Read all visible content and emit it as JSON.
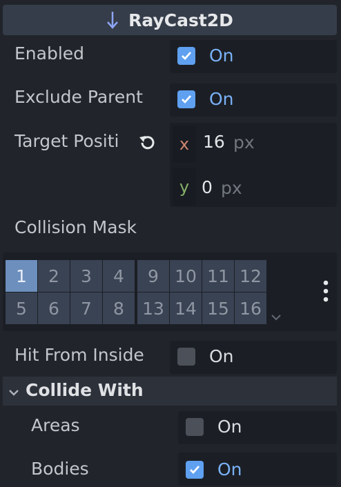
{
  "header": {
    "title": "RayCast2D",
    "icon": "down-arrow-icon"
  },
  "properties": {
    "enabled": {
      "label": "Enabled",
      "value": "On",
      "checked": true
    },
    "exclude_parent": {
      "label": "Exclude Parent",
      "value": "On",
      "checked": true
    },
    "target_position": {
      "label": "Target Positi",
      "x_label": "x",
      "x_value": "16",
      "y_label": "y",
      "y_value": "0",
      "unit": "px"
    },
    "collision_mask": {
      "label": "Collision Mask",
      "active_layer": 1,
      "layers": [
        "1",
        "2",
        "3",
        "4",
        "5",
        "6",
        "7",
        "8",
        "9",
        "10",
        "11",
        "12",
        "13",
        "14",
        "15",
        "16"
      ]
    },
    "hit_from_inside": {
      "label": "Hit From Inside",
      "value": "On",
      "checked": false
    }
  },
  "collide_with": {
    "title": "Collide With",
    "areas": {
      "label": "Areas",
      "value": "On",
      "checked": false
    },
    "bodies": {
      "label": "Bodies",
      "value": "On",
      "checked": true
    }
  },
  "colors": {
    "accent": "#5fa0f0",
    "x_axis": "#d08770",
    "y_axis": "#88b06a",
    "header_arrow": "#8da5f3"
  }
}
